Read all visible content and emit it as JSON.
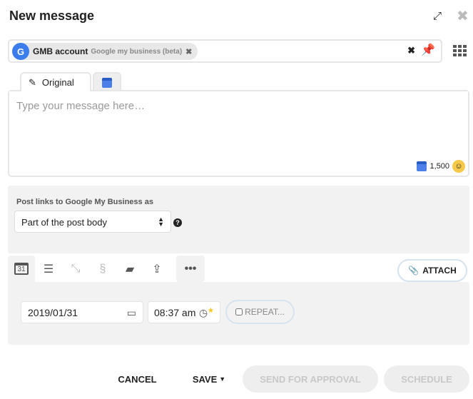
{
  "header": {
    "title": "New message"
  },
  "account": {
    "name": "GMB account",
    "type": "Google my business (beta)",
    "avatar_letter": "G"
  },
  "tabs": [
    {
      "label": "Original"
    }
  ],
  "message": {
    "placeholder": "Type your message here…",
    "char_count": "1,500"
  },
  "links": {
    "label": "Post links to Google My Business as",
    "selected": "Part of the post body"
  },
  "toolbar": {
    "attach_label": "ATTACH",
    "calendar_day": "31"
  },
  "schedule": {
    "date": "2019/01/31",
    "time": "08:37 am",
    "repeat_label": "REPEAT..."
  },
  "footer": {
    "cancel": "CANCEL",
    "save": "SAVE",
    "send_for_approval": "SEND FOR APPROVAL",
    "schedule": "SCHEDULE"
  }
}
